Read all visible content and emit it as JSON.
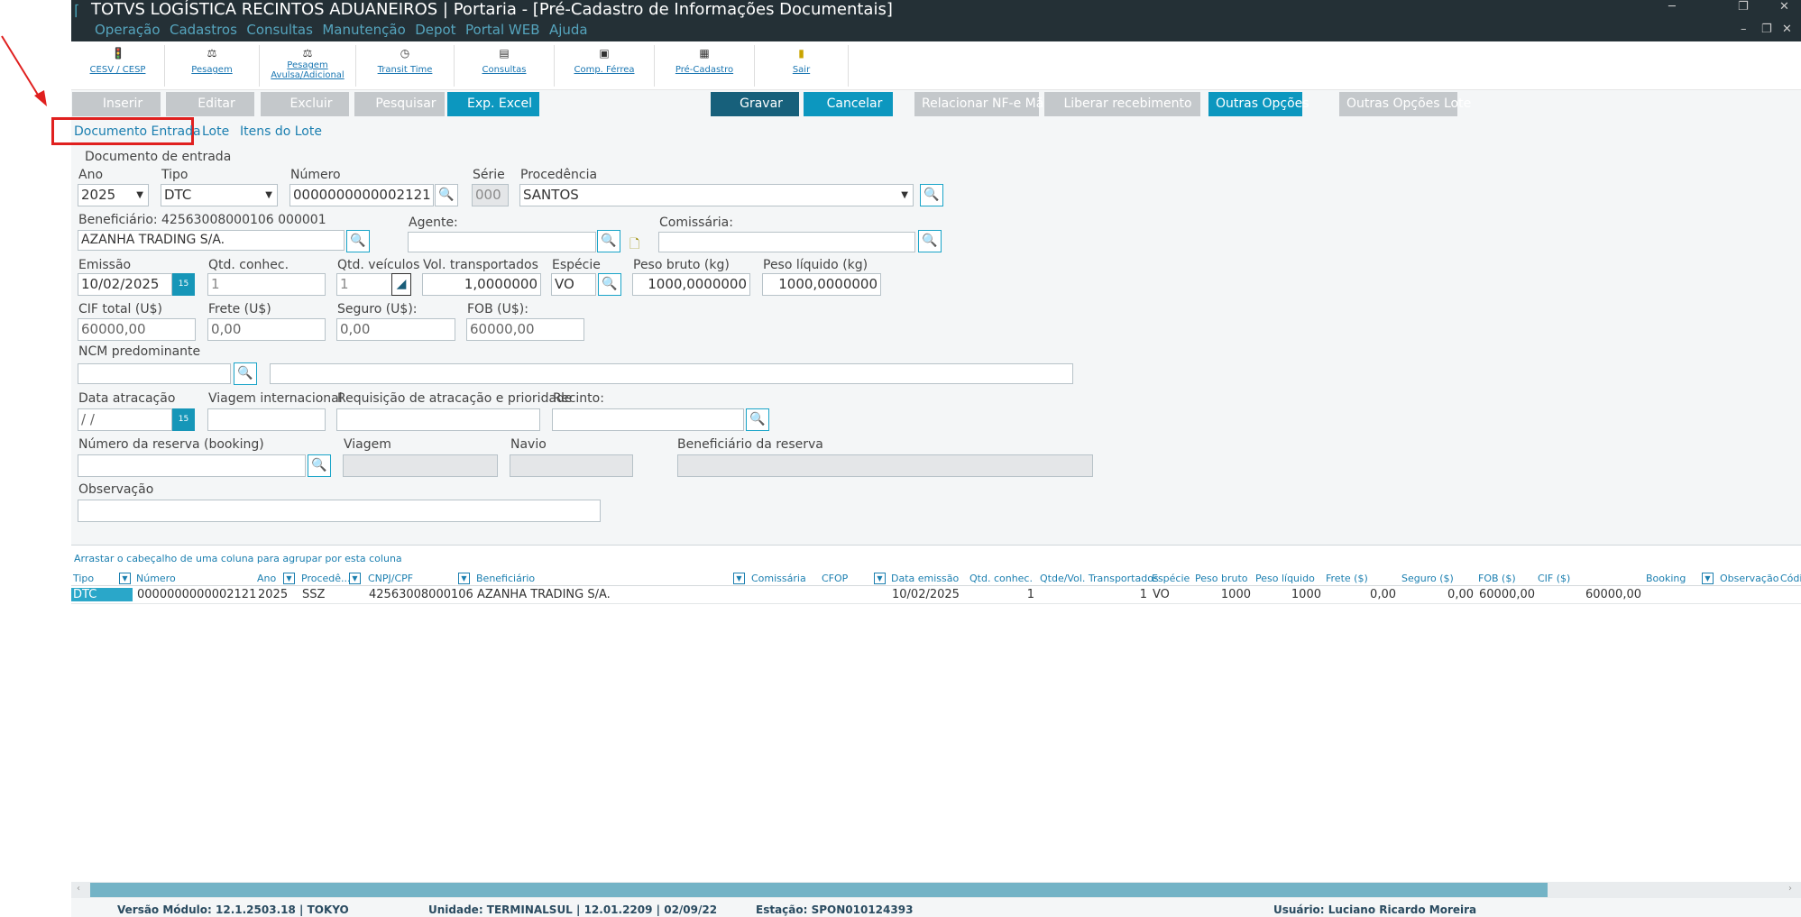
{
  "window": {
    "title": "TOTVS LOGÍSTICA RECINTOS ADUANEIROS | Portaria - [Pré-Cadastro de Informações Documentais]",
    "min": "─",
    "restore": "❐",
    "close": "✕",
    "sub_min": "–",
    "sub_restore": "❐",
    "sub_close": "✕"
  },
  "menu": [
    "Operação",
    "Cadastros",
    "Consultas",
    "Manutenção",
    "Depot",
    "Portal WEB",
    "Ajuda"
  ],
  "toolbar": [
    {
      "label": "CESV / CESP",
      "icon": "traffic-light-icon"
    },
    {
      "label": "Pesagem",
      "icon": "scale-icon"
    },
    {
      "label": "Pesagem Avulsa/Adicional",
      "icon": "scale-icon"
    },
    {
      "label": "Transit Time",
      "icon": "clock-icon"
    },
    {
      "label": "Consultas",
      "icon": "printer-icon"
    },
    {
      "label": "Comp. Férrea",
      "icon": "train-icon"
    },
    {
      "label": "Pré-Cadastro",
      "icon": "document-icon"
    },
    {
      "label": "Sair",
      "icon": "exit-icon"
    }
  ],
  "actions": {
    "inserir": "Inserir",
    "editar": "Editar",
    "excluir": "Excluir",
    "pesquisar": "Pesquisar",
    "exp_excel": "Exp. Excel",
    "gravar": "Gravar",
    "cancelar": "Cancelar",
    "relacionar": "Relacionar NF-e Mãe",
    "liberar": "Liberar recebimento",
    "outras": "Outras Opções",
    "outras_lote": "Outras Opções Lote"
  },
  "tabs": [
    "Documento Entrada",
    "Lote",
    "Itens do Lote"
  ],
  "form": {
    "group_title": "Documento de entrada",
    "ano_label": "Ano",
    "ano": "2025",
    "tipo_label": "Tipo",
    "tipo": "DTC",
    "numero_label": "Número",
    "numero": "0000000000002121",
    "serie_label": "Série",
    "serie": "000",
    "procedencia_label": "Procedência",
    "procedencia": "SANTOS",
    "beneficiario_label": "Beneficiário:",
    "beneficiario_doc": "42563008000106  000001",
    "beneficiario": "AZANHA TRADING S/A.",
    "agente_label": "Agente:",
    "agente": "",
    "comissaria_label": "Comissária:",
    "comissaria": "",
    "emissao_label": "Emissão",
    "emissao": "10/02/2025",
    "qtd_conhec_label": "Qtd. conhec.",
    "qtd_conhec": "1",
    "qtd_veiculos_label": "Qtd. veículos",
    "qtd_veiculos": "1",
    "vol_label": "Vol. transportados",
    "vol": "1,0000000",
    "especie_label": "Espécie",
    "especie": "VO",
    "peso_bruto_label": "Peso bruto (kg)",
    "peso_bruto": "1000,0000000",
    "peso_liquido_label": "Peso líquido (kg)",
    "peso_liquido": "1000,0000000",
    "cif_label": "CIF total (U$)",
    "cif": "60000,00",
    "frete_label": "Frete (U$)",
    "frete": "0,00",
    "seguro_label": "Seguro (U$):",
    "seguro": "0,00",
    "fob_label": "FOB (U$):",
    "fob": "60000,00",
    "ncm_label": "NCM predominante",
    "ncm": "",
    "ncm_desc": "",
    "data_atrac_label": "Data atracação",
    "data_atrac": "  /  /",
    "viagem_int_label": "Viagem internacional",
    "viagem_int": "",
    "requisicao_label": "Requisição de atracação e prioridade",
    "requisicao": "",
    "recinto_label": "Recinto:",
    "recinto": "",
    "reserva_label": "Número da reserva (booking)",
    "reserva": "",
    "viagem_label": "Viagem",
    "navio_label": "Navio",
    "benef_reserva_label": "Beneficiário da reserva",
    "obs_label": "Observação",
    "obs": ""
  },
  "grid": {
    "group_hint": "Arrastar o cabeçalho de uma coluna para agrupar por esta coluna",
    "headers": [
      "Tipo",
      "Número",
      "Ano",
      "Procedê...",
      "CNPJ/CPF",
      "Beneficiário",
      "Comissária",
      "CFOP",
      "Data emissão",
      "Qtd. conhec.",
      "Qtde/Vol. Transportados",
      "Espécie",
      "Peso bruto",
      "Peso líquido",
      "Frete ($)",
      "Seguro ($)",
      "FOB ($)",
      "CIF ($)",
      "Booking",
      "Observação",
      "Códi"
    ],
    "row": [
      "DTC",
      "0000000000002121",
      "2025",
      "SSZ",
      "42563008000106",
      "AZANHA TRADING S/A.",
      "",
      "",
      "10/02/2025",
      "1",
      "1",
      "VO",
      "1000",
      "1000",
      "0,00",
      "0,00",
      "60000,00",
      "60000,00",
      "",
      "",
      ""
    ]
  },
  "status": {
    "versao": "Versão Módulo:   12.1.2503.18  |  TOKYO",
    "unidade": "Unidade: TERMINALSUL | 12.01.2209 | 02/09/22",
    "estacao": "Estação: SPON010124393",
    "usuario": "Usuário: Luciano Ricardo Moreira"
  }
}
